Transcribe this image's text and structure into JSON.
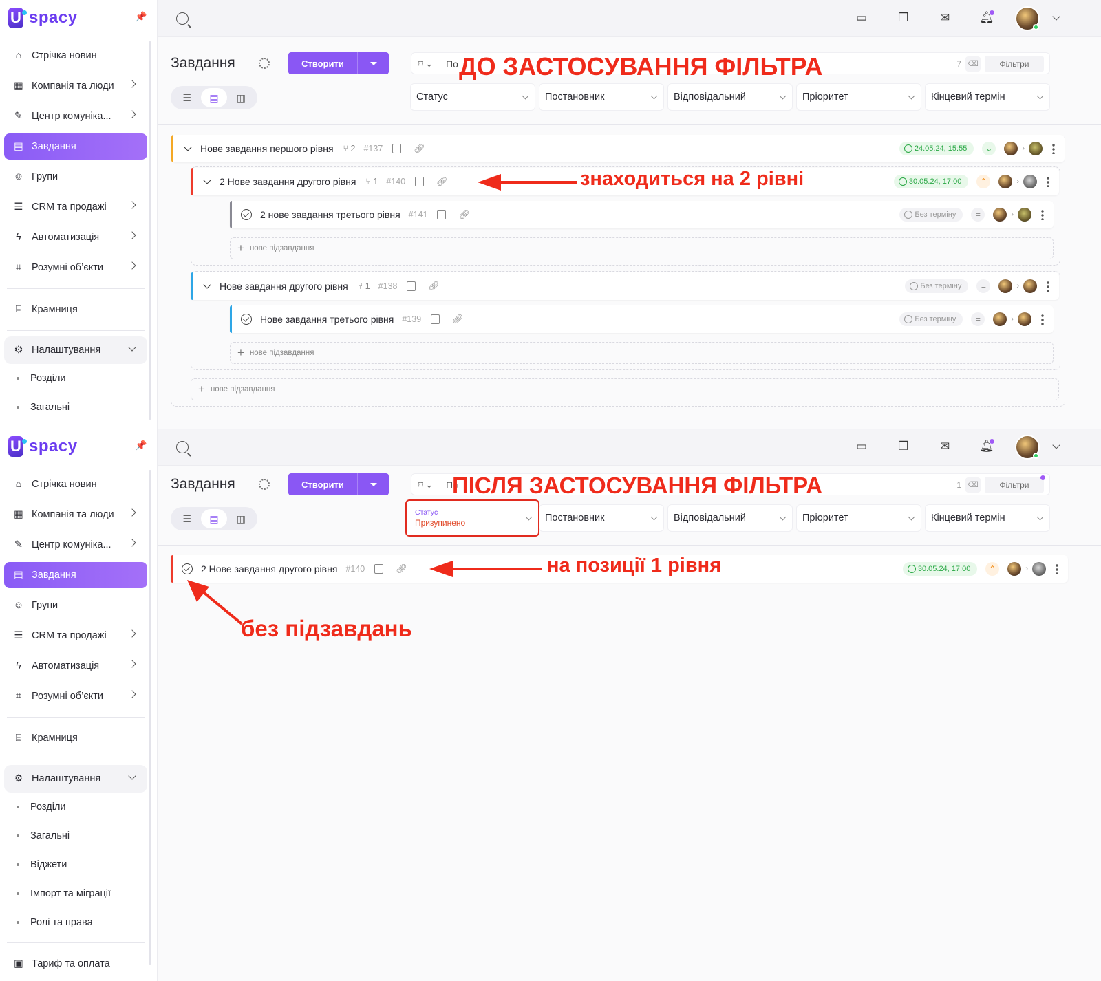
{
  "app": {
    "logo_text": "spacy"
  },
  "sidebar": {
    "items": [
      {
        "label": "Стрічка новин",
        "icon": "home-icon"
      },
      {
        "label": "Компанія та люди",
        "icon": "building-icon"
      },
      {
        "label": "Центр комуніка...",
        "icon": "edit-icon"
      },
      {
        "label": "Завдання",
        "icon": "calendar-icon"
      },
      {
        "label": "Групи",
        "icon": "users-icon"
      },
      {
        "label": "CRM та продажі",
        "icon": "database-icon"
      },
      {
        "label": "Автоматизація",
        "icon": "lightning-icon"
      },
      {
        "label": "Розумні об’єкти",
        "icon": "scan-icon"
      },
      {
        "label": "Крамниця",
        "icon": "store-icon"
      },
      {
        "label": "Налаштування",
        "icon": "gear-icon"
      }
    ],
    "settings_sub_top": [
      "Розділи",
      "Загальні"
    ],
    "settings_sub_bottom": [
      "Розділи",
      "Загальні",
      "Віджети",
      "Імпорт та міграції",
      "Ролі та права"
    ],
    "billing": "Тариф та оплата"
  },
  "page": {
    "title": "Завдання",
    "create_button": "Створити",
    "search_placeholder": "По",
    "filters_button": "Фільтри"
  },
  "filters": {
    "status": "Статус",
    "creator": "Постановник",
    "responsible": "Відповідальний",
    "priority": "Пріоритет",
    "deadline": "Кінцевий термін",
    "status_selected_value": "Призупинено"
  },
  "top": {
    "result_count": "7",
    "tasks": {
      "t137": {
        "title": "Нове завдання першого рівня",
        "subtasks": "2",
        "number": "#137",
        "deadline": "24.05.24, 15:55"
      },
      "t140": {
        "title": "2 Нове завдання другого рівня",
        "subtasks": "1",
        "number": "#140",
        "deadline": "30.05.24, 17:00"
      },
      "t141": {
        "title": "2 нове завдання третього рівня",
        "number": "#141",
        "deadline": "Без терміну"
      },
      "t138": {
        "title": "Нове завдання другого рівня",
        "subtasks": "1",
        "number": "#138",
        "deadline": "Без терміну"
      },
      "t139": {
        "title": "Нове завдання третього рівня",
        "number": "#139",
        "deadline": "Без терміну"
      }
    },
    "add_subtask": "нове підзавдання"
  },
  "bottom": {
    "result_count": "1",
    "task": {
      "title": "2 Нове завдання другого рівня",
      "number": "#140",
      "deadline": "30.05.24, 17:00"
    }
  },
  "annotations": {
    "before": "ДО ЗАСТОСУВАННЯ ФІЛЬТРА",
    "level2": "знаходиться на 2 рівні",
    "after": "ПІСЛЯ ЗАСТОСУВАННЯ ФІЛЬТРА",
    "level1": "на позиції 1 рівня",
    "no_subtasks": "без підзавдань"
  },
  "colors": {
    "accent": "#8a57f4",
    "annotation_red": "#ef2b1b",
    "deadline_green": "#2aa845",
    "priority_orange": "#f28a10"
  }
}
